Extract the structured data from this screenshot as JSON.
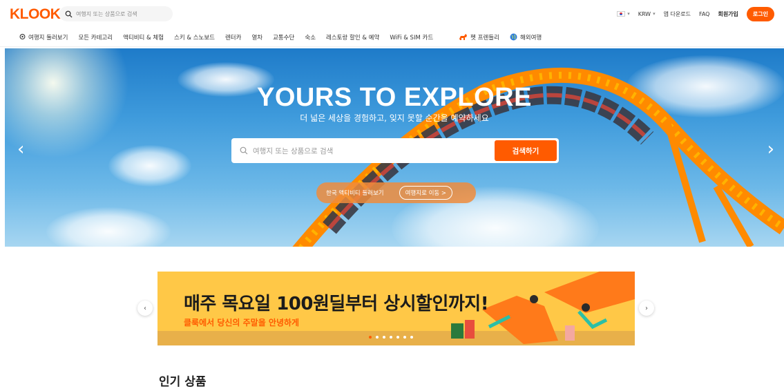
{
  "header": {
    "logo": "KLOOK",
    "search_placeholder": "여행지 또는 상품으로 검색",
    "currency": "KRW",
    "app_download": "앱 다운로드",
    "faq": "FAQ",
    "signup": "회원가입",
    "login": "로그인"
  },
  "nav": {
    "items": [
      {
        "label": "여행지 둘러보기",
        "icon": "location-pin-icon"
      },
      {
        "label": "모든 카테고리"
      },
      {
        "label": "액티비티 & 체험"
      },
      {
        "label": "스키 & 스노보드"
      },
      {
        "label": "렌터카"
      },
      {
        "label": "열차"
      },
      {
        "label": "교통수단"
      },
      {
        "label": "숙소"
      },
      {
        "label": "레스토랑 할인 & 예약"
      },
      {
        "label": "WiFi & SIM 카드"
      }
    ],
    "extra": [
      {
        "label": "펫 프렌들리",
        "icon": "dog-icon"
      },
      {
        "label": "해외여행",
        "icon": "globe-icon"
      }
    ]
  },
  "hero": {
    "title": "YOURS TO EXPLORE",
    "subtitle": "더 넓은 세상을 경험하고, 잊지 못할 순간을 예약하세요",
    "search_placeholder": "여행지 또는 상품으로 검색",
    "search_button": "검색하기",
    "pill_label": "한국 액티비티 둘러보기",
    "pill_button": "여행지로 이동 >"
  },
  "banner": {
    "title": "매주 목요일 100원딜부터 상시할인까지!",
    "subtitle": "클룩에서 당신의 주말을 안녕하게",
    "slide_count": 7,
    "active_slide": 1
  },
  "section": {
    "title": "인기 상품"
  },
  "colors": {
    "brand": "#ff5b00",
    "banner_bg": "#ffc847"
  }
}
